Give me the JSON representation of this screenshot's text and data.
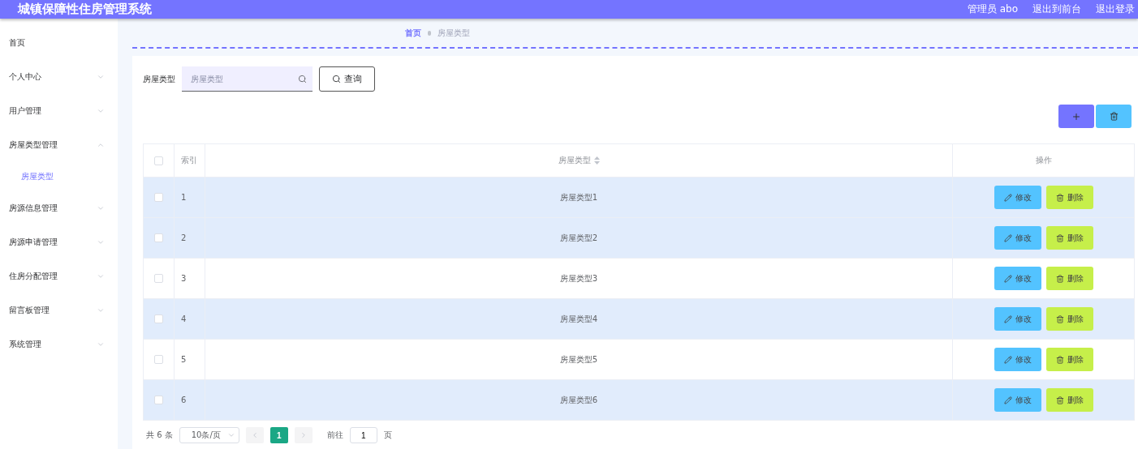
{
  "header": {
    "title": "城镇保障性住房管理系统",
    "links": [
      "管理员 abo",
      "退出到前台",
      "退出登录"
    ]
  },
  "sidebar": {
    "items": [
      {
        "label": "首页",
        "selected": false
      },
      {
        "label": "个人中心",
        "selected": false,
        "expanded": false
      },
      {
        "label": "用户管理",
        "selected": false,
        "expanded": false
      },
      {
        "label": "房屋类型管理",
        "selected": false,
        "expanded": true,
        "children": [
          {
            "label": "房屋类型",
            "selected": true
          }
        ]
      },
      {
        "label": "房源信息管理",
        "selected": false,
        "expanded": false
      },
      {
        "label": "房源申请管理",
        "selected": false,
        "expanded": false
      },
      {
        "label": "住房分配管理",
        "selected": false,
        "expanded": false
      },
      {
        "label": "留言板管理",
        "selected": false,
        "expanded": false
      },
      {
        "label": "系统管理",
        "selected": false,
        "expanded": false
      }
    ]
  },
  "breadcrumb": [
    "首页",
    "房屋类型"
  ],
  "search": {
    "label": "房屋类型",
    "placeholder": "房屋类型",
    "button": "查询"
  },
  "table": {
    "columns": [
      "索引",
      "房屋类型",
      "操作"
    ],
    "all_checked": false,
    "rows": [
      {
        "index": "1",
        "type": "房屋类型1",
        "checked": false,
        "highlighted": true,
        "actions": [
          "修改",
          "删除"
        ]
      },
      {
        "index": "2",
        "type": "房屋类型2",
        "checked": false,
        "highlighted": true,
        "actions": [
          "修改",
          "删除"
        ]
      },
      {
        "index": "3",
        "type": "房屋类型3",
        "checked": false,
        "highlighted": false,
        "actions": [
          "修改",
          "删除"
        ]
      },
      {
        "index": "4",
        "type": "房屋类型4",
        "checked": false,
        "highlighted": true,
        "actions": [
          "修改",
          "删除"
        ]
      },
      {
        "index": "5",
        "type": "房屋类型5",
        "checked": false,
        "highlighted": false,
        "actions": [
          "修改",
          "删除"
        ]
      },
      {
        "index": "6",
        "type": "房屋类型6",
        "checked": false,
        "highlighted": true,
        "actions": [
          "修改",
          "删除"
        ]
      }
    ]
  },
  "pagination": {
    "total": "共 6 条",
    "page_size": "10条/页",
    "pages": [
      {
        "label": "1",
        "selected": true
      }
    ],
    "goto_label": "前往",
    "goto_value": "1",
    "goto_suffix": "页"
  }
}
